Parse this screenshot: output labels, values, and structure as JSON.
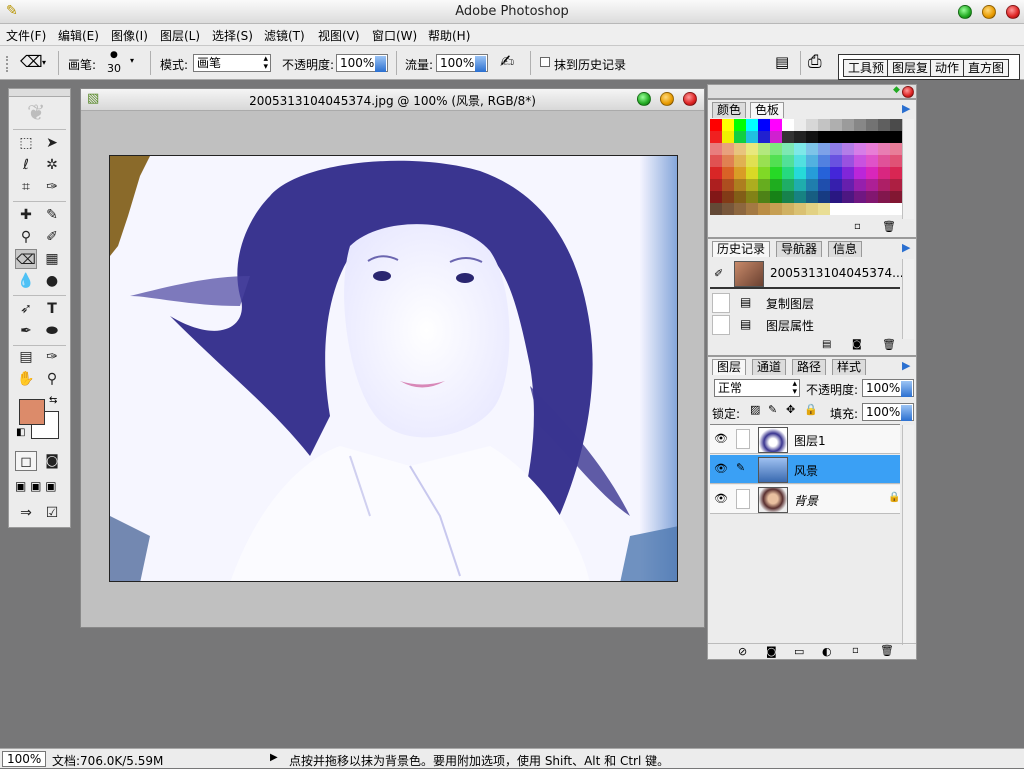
{
  "app": {
    "title": "Adobe Photoshop"
  },
  "menu": [
    "文件(F)",
    "编辑(E)",
    "图像(I)",
    "图层(L)",
    "选择(S)",
    "滤镜(T)",
    "视图(V)",
    "窗口(W)",
    "帮助(H)"
  ],
  "options": {
    "brush_label": "画笔:",
    "brush_size": "30",
    "mode_label": "模式:",
    "mode_value": "画笔",
    "opacity_label": "不透明度:",
    "opacity_value": "100%",
    "flow_label": "流量:",
    "flow_value": "100%",
    "erase_history_label": "抹到历史记录",
    "palette_well_tabs": [
      "工具预",
      "图层复",
      "动作",
      "直方图"
    ]
  },
  "document": {
    "title": "2005313104045374.jpg @ 100% (风景, RGB/8*)"
  },
  "color_palette": {
    "tabs": [
      "颜色",
      "色板"
    ]
  },
  "history_palette": {
    "tabs": [
      "历史记录",
      "导航器",
      "信息"
    ],
    "snapshot": "2005313104045374...",
    "items": [
      "复制图层",
      "图层属性"
    ]
  },
  "layers_palette": {
    "tabs": [
      "图层",
      "通道",
      "路径",
      "样式"
    ],
    "blend_mode": "正常",
    "opacity_label": "不透明度:",
    "opacity_value": "100%",
    "lock_label": "锁定:",
    "fill_label": "填充:",
    "fill_value": "100%",
    "layers": [
      {
        "name": "图层1"
      },
      {
        "name": "风景"
      },
      {
        "name": "背景"
      }
    ]
  },
  "status": {
    "zoom": "100%",
    "doc_size": "文档:706.0K/5.59M",
    "hint": "点按并拖移以抹为背景色。要用附加选项，使用 Shift、Alt 和 Ctrl 键。"
  },
  "colors": {
    "foreground": "#dc8b6a",
    "background": "#ffffff",
    "selected_layer": "#3aa0f5",
    "tint": "#3a3590"
  },
  "icons": [
    "eraser-icon",
    "brush-preset-icon",
    "airbrush-icon",
    "file-browser-icon",
    "palette-well-icon",
    "eye-icon",
    "paintbrush-link-icon",
    "lock-icon",
    "trash-icon",
    "new-layer-icon",
    "layer-style-icon",
    "mask-icon",
    "folder-icon",
    "adjustment-icon"
  ]
}
